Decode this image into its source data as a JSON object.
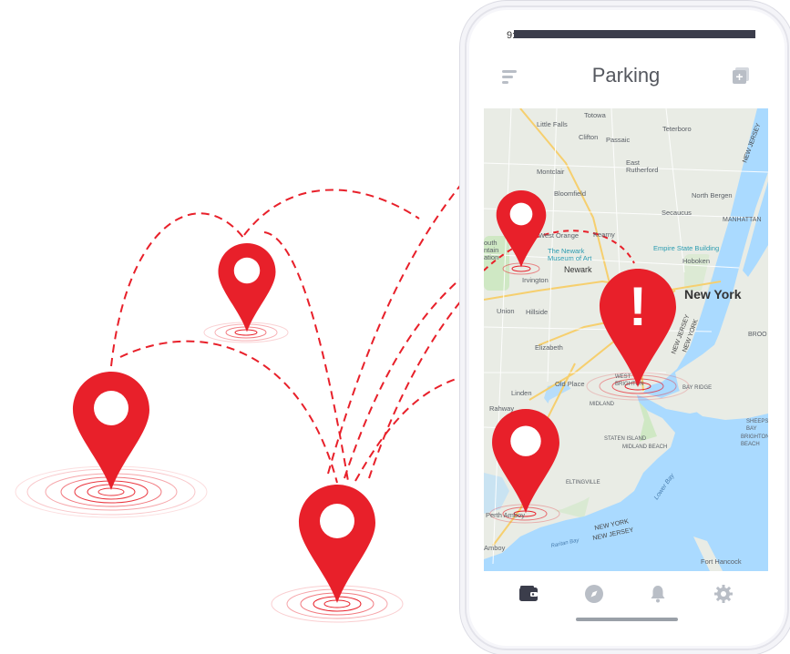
{
  "status_bar": {
    "time": "9:41"
  },
  "header": {
    "title": "Parking",
    "menu_icon": "sort-icon",
    "action_icon": "add-note-icon"
  },
  "map": {
    "labels": {
      "little_falls": "Little Falls",
      "totowa": "Totowa",
      "teterboro": "Teterboro",
      "clifton": "Clifton",
      "passaic": "Passaic",
      "east_rutherford": "East\nRutherford",
      "montclair": "Montclair",
      "bloomfield": "Bloomfield",
      "north_bergen": "North Bergen",
      "secaucus": "Secaucus",
      "manhattan": "MANHATTAN",
      "west_orange": "West Orange",
      "kearny": "Kearny",
      "empire_state": "Empire State Building",
      "newark_museum": "The Newark\nMuseum of Art",
      "hoboken": "Hoboken",
      "newark": "Newark",
      "irvington": "Irvington",
      "new_york": "New York",
      "new_jersey_1": "NEW JERSEY",
      "new_jersey_2": "NEW JERSEY",
      "new_york_state": "NEW YORK",
      "union": "Union",
      "hillside": "Hillside",
      "brooklyn": "BROO",
      "elizabeth": "Elizabeth",
      "old_place": "Old Place",
      "bay_ridge": "BAY RIDGE",
      "linden": "Linden",
      "midland": "MIDLAND",
      "rahway": "Rahway",
      "staten_island": "STATEN ISLAND",
      "midland_beach": "MIDLAND BEACH",
      "eltingville": "ELTINGVILLE",
      "lower_bay": "Lower Bay",
      "perth_amboy": "Perth Amboy",
      "raritan_bay": "Raritan Bay",
      "new_york_border": "NEW YORK",
      "new_jersey_border": "NEW JERSEY",
      "fort_hancock": "Fort Hancock",
      "brighton_beach": "BRIGHTON\nBEACH",
      "sheepshead": "SHEEPS\nBAY",
      "west_brighton": "WEST\nBRIGHTON",
      "amboy": "Amboy",
      "south_orange": "outh\nntain\nation"
    }
  },
  "alert": {
    "symbol": "!"
  },
  "bottom_nav": [
    {
      "name": "nav-wallet",
      "icon": "wallet-icon",
      "active": true
    },
    {
      "name": "nav-explore",
      "icon": "compass-icon",
      "active": false
    },
    {
      "name": "nav-notifications",
      "icon": "bell-icon",
      "active": false
    },
    {
      "name": "nav-settings",
      "icon": "gear-icon",
      "active": false
    }
  ],
  "colors": {
    "pin": "#e8202a",
    "route": "#e8202a",
    "water": "#aadaff",
    "land": "#e9ece5",
    "park": "#cfe8c4",
    "nav_active": "#3b3d4b",
    "nav_inactive": "#b9bec6",
    "title": "#55585f"
  }
}
